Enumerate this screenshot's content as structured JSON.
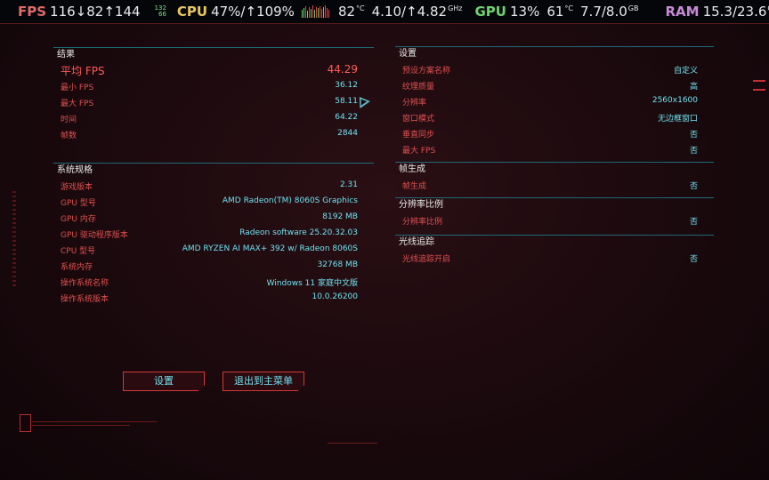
{
  "overlay": {
    "fps_label": "FPS",
    "fps_values": "116↓82↑144",
    "fps_mini_top": "132",
    "fps_mini_bottom": "66",
    "cpu_label": "CPU",
    "cpu_values": "47%/↑109%",
    "cpu_temp": "82",
    "temp_unit": "°C",
    "cpu_clock": "4.10/↑4.82",
    "clock_unit": "GHz",
    "gpu_label": "GPU",
    "gpu_usage": "13%",
    "gpu_temp": "61",
    "vram": "7.7/8.0",
    "mem_unit": "GB",
    "ram_label": "RAM",
    "ram": "15.3/23.6"
  },
  "results": {
    "title": "结果",
    "rows": [
      {
        "label": "平均 FPS",
        "value": "44.29"
      },
      {
        "label": "最小 FPS",
        "value": "36.12"
      },
      {
        "label": "最大 FPS",
        "value": "58.11"
      },
      {
        "label": "时间",
        "value": "64.22"
      },
      {
        "label": "帧数",
        "value": "2844"
      }
    ]
  },
  "specs": {
    "title": "系统规格",
    "rows": [
      {
        "label": "游戏版本",
        "value": "2.31"
      },
      {
        "label": "GPU 型号",
        "value": "AMD Radeon(TM) 8060S Graphics"
      },
      {
        "label": "GPU 内存",
        "value": "8192 MB"
      },
      {
        "label": "GPU 驱动程序版本",
        "value": "Radeon software 25.20.32.03"
      },
      {
        "label": "CPU 型号",
        "value": "AMD RYZEN AI MAX+ 392 w/ Radeon 8060S"
      },
      {
        "label": "系统内存",
        "value": "32768 MB"
      },
      {
        "label": "操作系统名称",
        "value": "Windows 11 家庭中文版"
      },
      {
        "label": "操作系统版本",
        "value": "10.0.26200"
      }
    ]
  },
  "settings": {
    "title": "设置",
    "rows": [
      {
        "label": "预设方案名称",
        "value": "自定义"
      },
      {
        "label": "纹理质量",
        "value": "高"
      },
      {
        "label": "分辨率",
        "value": "2560x1600"
      },
      {
        "label": "窗口模式",
        "value": "无边框窗口"
      },
      {
        "label": "垂直同步",
        "value": "否"
      },
      {
        "label": "最大 FPS",
        "value": "否"
      }
    ]
  },
  "frame_gen": {
    "title": "帧生成",
    "rows": [
      {
        "label": "帧生成",
        "value": "否"
      }
    ]
  },
  "res_scale": {
    "title": "分辨率比例",
    "rows": [
      {
        "label": "分辨率比例",
        "value": "否"
      }
    ]
  },
  "ray_tracing": {
    "title": "光线追踪",
    "rows": [
      {
        "label": "光线追踪开启",
        "value": "否"
      }
    ]
  },
  "buttons": {
    "settings": "设置",
    "exit": "退出到主菜单"
  },
  "colors": {
    "accent_red": "#e04a4a",
    "accent_cyan": "#6fe0ee",
    "panel_line": "#1d6a78"
  }
}
